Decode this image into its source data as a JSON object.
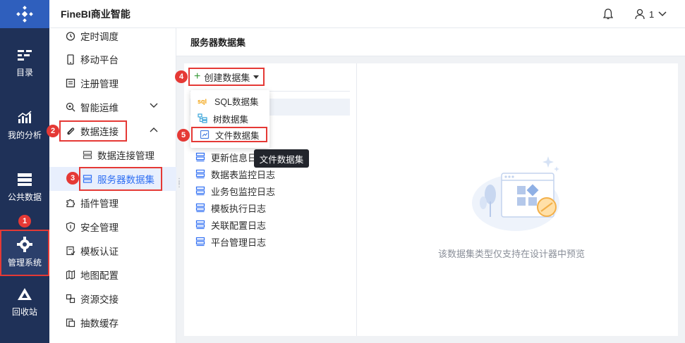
{
  "app": {
    "title": "FineBI商业智能"
  },
  "user": {
    "name": "1"
  },
  "rail": [
    {
      "label": "目录"
    },
    {
      "label": "我的分析"
    },
    {
      "label": "公共数据"
    },
    {
      "label": "管理系统"
    },
    {
      "label": "回收站"
    }
  ],
  "sidebar": [
    {
      "label": "定时调度"
    },
    {
      "label": "移动平台"
    },
    {
      "label": "注册管理"
    },
    {
      "label": "智能运维"
    },
    {
      "label": "数据连接"
    },
    {
      "label": "数据连接管理"
    },
    {
      "label": "服务器数据集"
    },
    {
      "label": "插件管理"
    },
    {
      "label": "安全管理"
    },
    {
      "label": "模板认证"
    },
    {
      "label": "地图配置"
    },
    {
      "label": "资源交接"
    },
    {
      "label": "抽数缓存"
    }
  ],
  "page": {
    "title": "服务器数据集",
    "empty_text": "该数据集类型仅支持在设计器中预览"
  },
  "toolbar": {
    "create_label": "创建数据集"
  },
  "dropdown": [
    {
      "label": "SQL数据集"
    },
    {
      "label": "树数据集"
    },
    {
      "label": "文件数据集"
    }
  ],
  "tooltip": {
    "text": "文件数据集"
  },
  "datasets": [
    {
      "label": "更新信息日"
    },
    {
      "label": "数据表监控日志"
    },
    {
      "label": "业务包监控日志"
    },
    {
      "label": "模板执行日志"
    },
    {
      "label": "关联配置日志"
    },
    {
      "label": "平台管理日志"
    }
  ],
  "badges": [
    "1",
    "2",
    "3",
    "4",
    "5"
  ],
  "colors": {
    "rail": "#1f3158",
    "accent": "#2f6ff3",
    "badge": "#e53935"
  }
}
